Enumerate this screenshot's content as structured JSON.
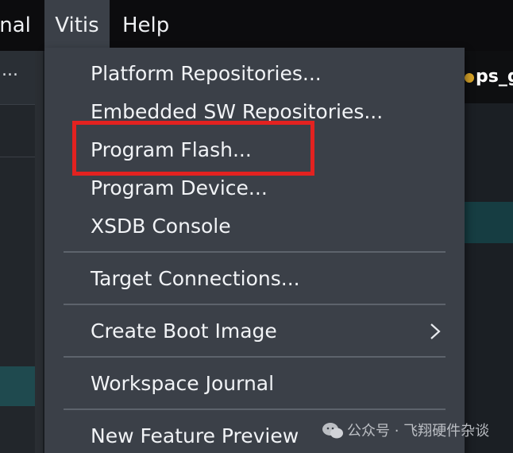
{
  "menubar": {
    "items": [
      {
        "label": "Terminal",
        "visible_text": "inal"
      },
      {
        "label": "Vitis"
      },
      {
        "label": "Help"
      }
    ]
  },
  "left_panel": {
    "tab_text": "..."
  },
  "editor": {
    "tab_title": "ps_gp",
    "tab_marker_color": "#d8a429"
  },
  "dropdown": {
    "items": [
      {
        "label": "Platform Repositories..."
      },
      {
        "label": "Embedded SW Repositories..."
      },
      {
        "label": "Program Flash...",
        "highlighted": true
      },
      {
        "label": "Program Device..."
      },
      {
        "label": "XSDB Console"
      },
      {
        "label": "Target Connections..."
      },
      {
        "label": "Create Boot Image",
        "submenu": true
      },
      {
        "label": "Workspace Journal"
      },
      {
        "label": "New Feature Preview"
      }
    ],
    "highlight_color": "#e32220"
  },
  "watermark": {
    "text": "公众号 · 飞翔硬件杂谈"
  },
  "colors": {
    "menubar_bg": "#0c0c0e",
    "menu_bg": "#3b4048",
    "text": "#f1f3f6",
    "divider": "#5d636c"
  }
}
